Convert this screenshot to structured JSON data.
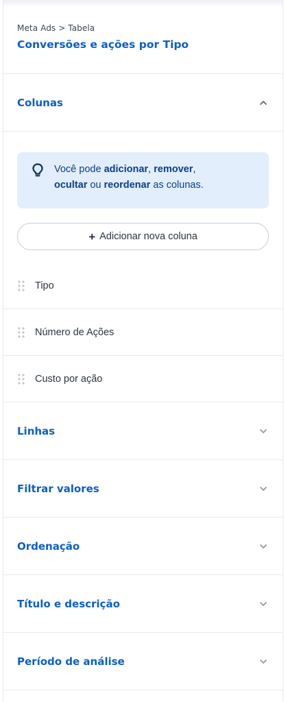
{
  "header": {
    "breadcrumb": "Meta Ads > Tabela",
    "title": "Conversões e ações por Tipo"
  },
  "sections": {
    "colunas": {
      "label": "Colunas",
      "expanded": true,
      "tip": {
        "part1": "Você pode ",
        "bold1": "adicionar",
        "part2": ", ",
        "bold2": "remover",
        "part3": ",",
        "bold3": "ocultar",
        "part4": " ou ",
        "bold4": "reordenar",
        "part5": " as colunas."
      },
      "add_button_label": "Adicionar nova coluna",
      "columns": [
        "Tipo",
        "Número de Ações",
        "Custo por ação"
      ]
    },
    "linhas": {
      "label": "Linhas"
    },
    "filtrar": {
      "label": "Filtrar valores"
    },
    "ordenacao": {
      "label": "Ordenação"
    },
    "titulo": {
      "label": "Título e descrição"
    },
    "periodo": {
      "label": "Período de análise"
    }
  },
  "icons": {
    "tip": "lightbulb-icon",
    "add": "plus-icon",
    "drag": "drag-handle-icon",
    "expanded": "chevron-up-icon",
    "collapsed": "chevron-down-icon"
  },
  "colors": {
    "accent": "#0b5fc6",
    "tip_background": "#e2eefc",
    "tip_text": "#0b3f86"
  }
}
